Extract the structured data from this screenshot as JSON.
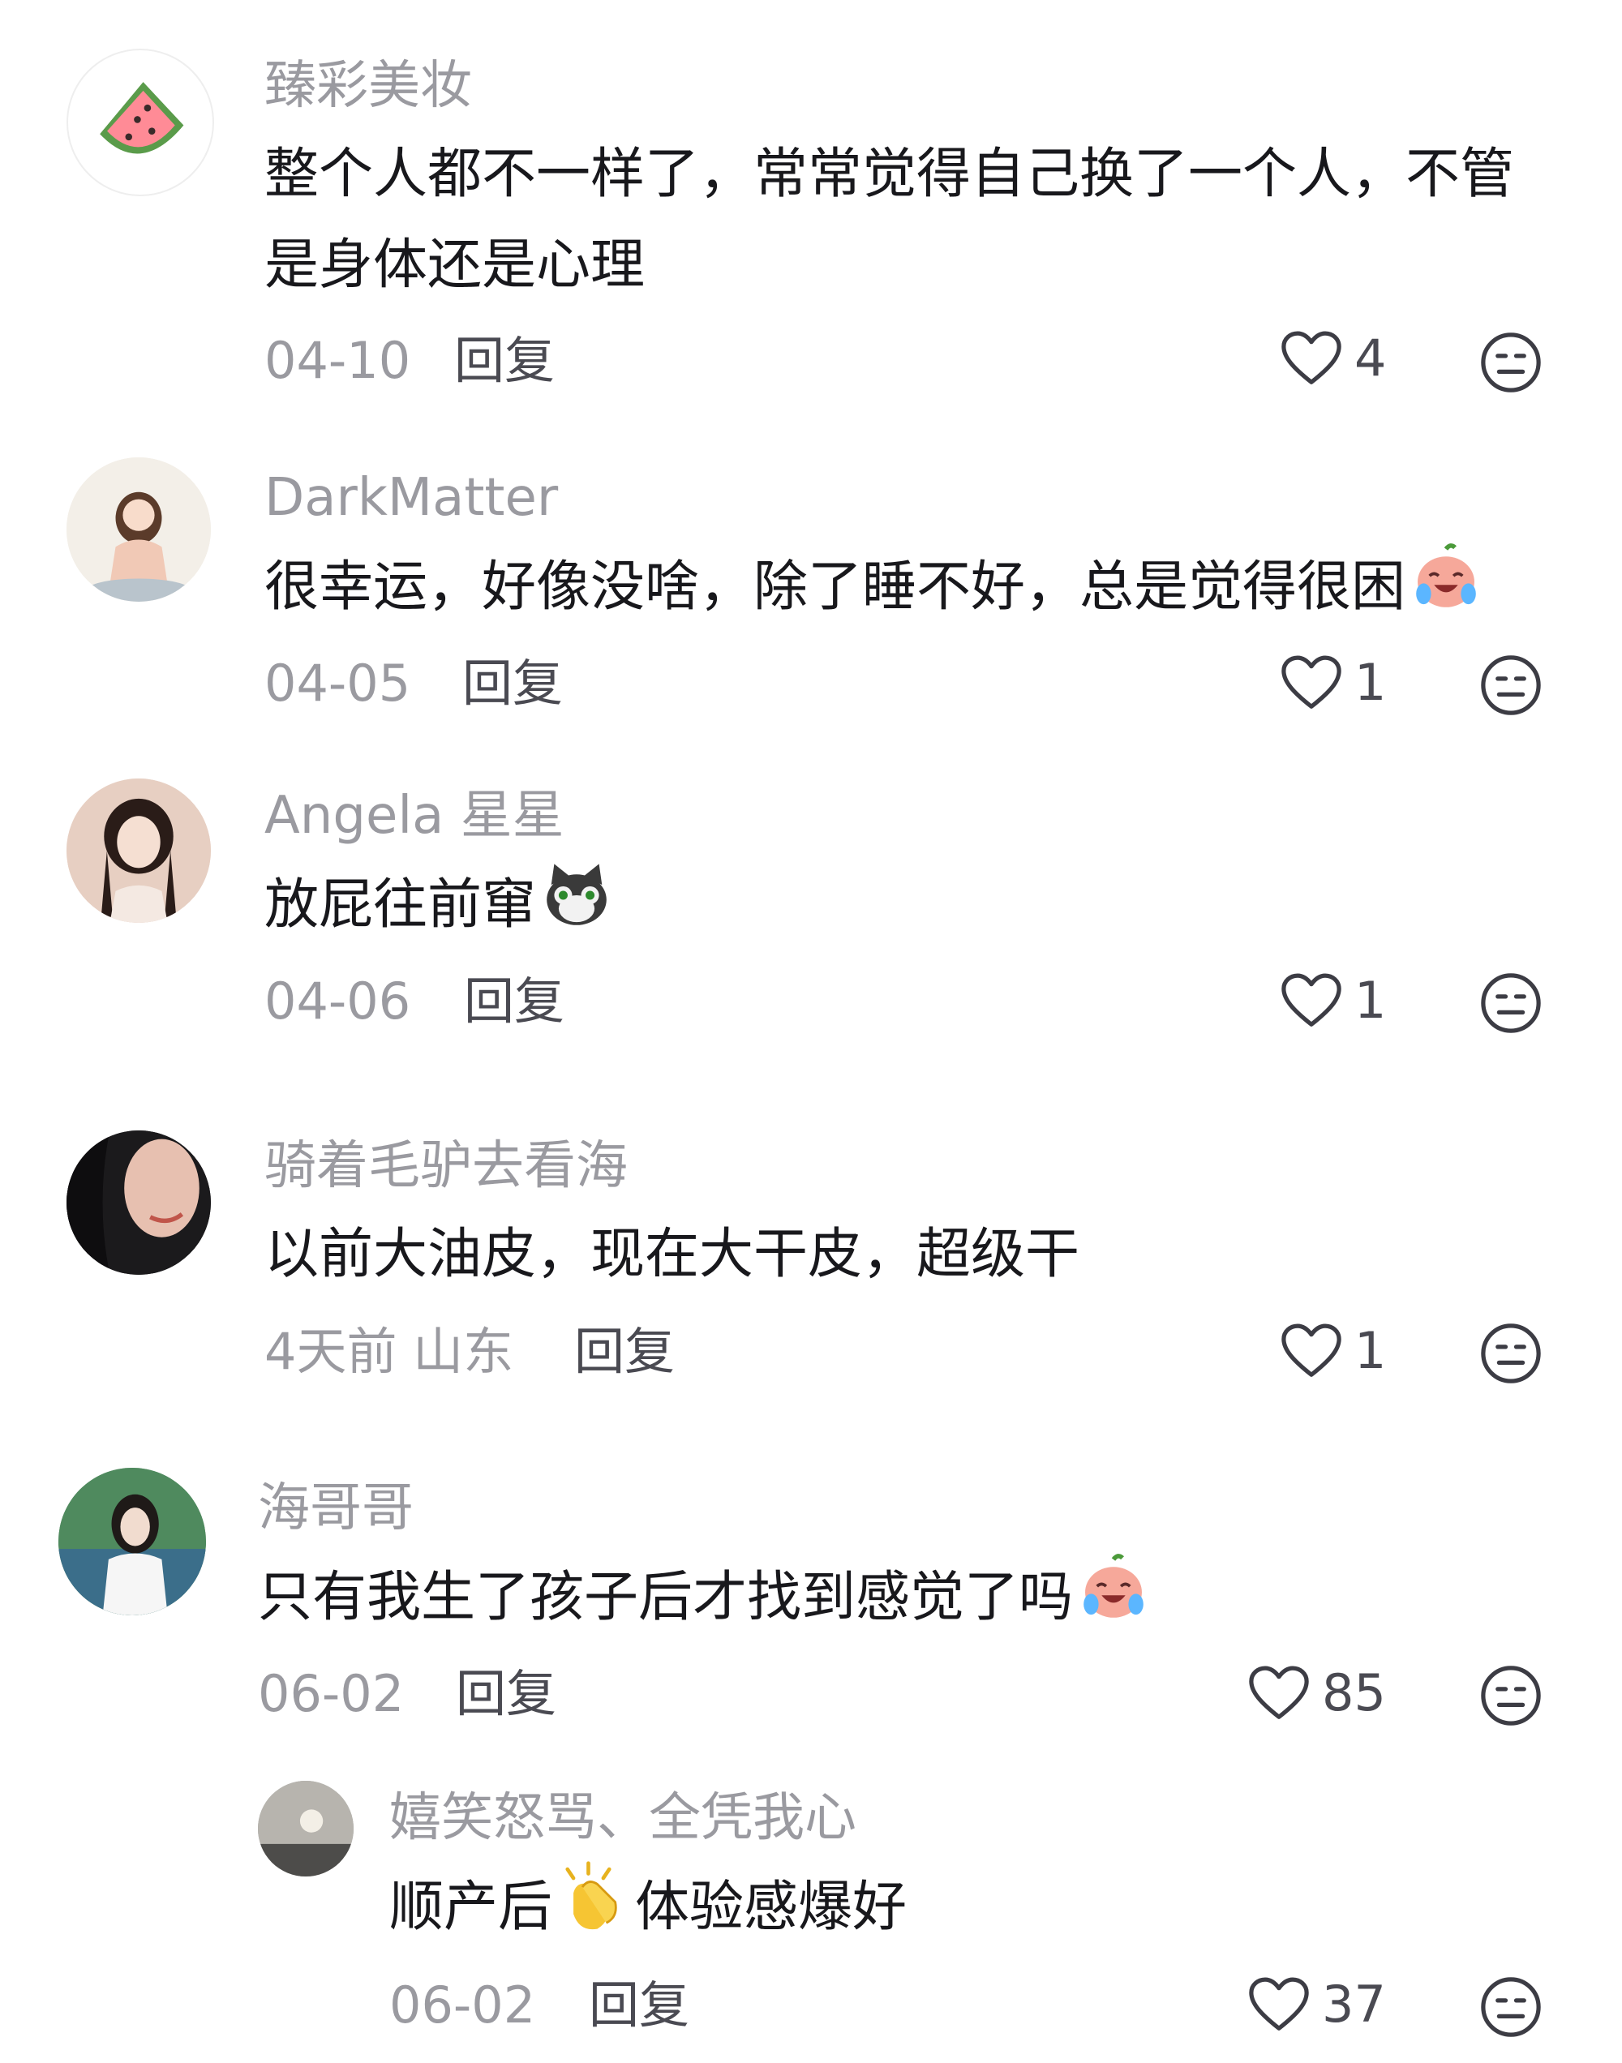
{
  "comments": [
    {
      "username": "臻彩美妆",
      "text": "整个人都不一样了，常常觉得自己换了一个人，不管是身体还是心理",
      "date": "04-10",
      "reply_label": "回复",
      "likes": "4",
      "emoji": ""
    },
    {
      "username": "DarkMatter",
      "text": "很幸运，好像没啥，除了睡不好，总是觉得很困",
      "date": "04-05",
      "reply_label": "回复",
      "likes": "1",
      "emoji": "crying-laugh"
    },
    {
      "username": "Angela 星星",
      "text": "放屁往前窜",
      "date": "04-06",
      "reply_label": "回复",
      "likes": "1",
      "emoji": "cat"
    },
    {
      "username": "骑着毛驴去看海",
      "text": "以前大油皮，现在大干皮，超级干",
      "date": "4天前 山东",
      "reply_label": "回复",
      "likes": "1",
      "emoji": ""
    },
    {
      "username": "海哥哥",
      "text": "只有我生了孩子后才找到感觉了吗",
      "date": "06-02",
      "reply_label": "回复",
      "likes": "85",
      "emoji": "crying-laugh"
    }
  ],
  "reply": {
    "username": "嬉笑怒骂、全凭我心",
    "text_before": "顺产后",
    "text_after": "体验感爆好",
    "emoji": "clapping-hands",
    "date": "06-02",
    "reply_label": "回复",
    "likes": "37"
  },
  "icons": {
    "like": "heart-outline-icon",
    "dislike": "meh-face-icon"
  },
  "colors": {
    "username": "#9a9aa0",
    "text": "#18181c",
    "icon": "#3c3c44"
  }
}
